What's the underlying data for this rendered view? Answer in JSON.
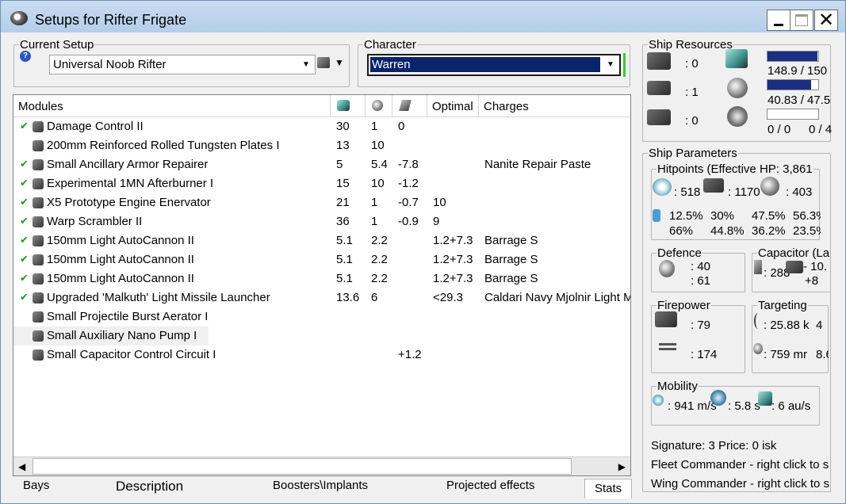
{
  "window": {
    "title": "Setups for Rifter Frigate",
    "minimize_label": "_",
    "close_label": "✕"
  },
  "current_setup": {
    "legend": "Current Setup",
    "help_label": "?",
    "value": "Universal Noob Rifter"
  },
  "character": {
    "legend": "Character",
    "value": "Warren"
  },
  "modules": {
    "headers": {
      "name": "Modules",
      "optimal": "Optimal",
      "charges": "Charges"
    },
    "rows": [
      {
        "checked": true,
        "name": "Damage Control II",
        "c1": "30",
        "c2": "1",
        "c3": "0",
        "optimal": "",
        "charges": ""
      },
      {
        "checked": false,
        "name": "200mm Reinforced Rolled Tungsten Plates I",
        "c1": "13",
        "c2": "10",
        "c3": "",
        "optimal": "",
        "charges": ""
      },
      {
        "checked": true,
        "name": "Small Ancillary Armor Repairer",
        "c1": "5",
        "c2": "5.4",
        "c3": "-7.8",
        "optimal": "",
        "charges": "Nanite Repair Paste"
      },
      {
        "checked": true,
        "name": "Experimental 1MN Afterburner I",
        "c1": "15",
        "c2": "10",
        "c3": "-1.2",
        "optimal": "",
        "charges": ""
      },
      {
        "checked": true,
        "name": "X5 Prototype Engine Enervator",
        "c1": "21",
        "c2": "1",
        "c3": "-0.7",
        "optimal": "10",
        "charges": ""
      },
      {
        "checked": true,
        "name": "Warp Scrambler II",
        "c1": "36",
        "c2": "1",
        "c3": "-0.9",
        "optimal": "9",
        "charges": ""
      },
      {
        "checked": true,
        "name": "150mm Light AutoCannon II",
        "c1": "5.1",
        "c2": "2.2",
        "c3": "",
        "optimal": "1.2+7.3",
        "charges": "Barrage S"
      },
      {
        "checked": true,
        "name": "150mm Light AutoCannon II",
        "c1": "5.1",
        "c2": "2.2",
        "c3": "",
        "optimal": "1.2+7.3",
        "charges": "Barrage S"
      },
      {
        "checked": true,
        "name": "150mm Light AutoCannon II",
        "c1": "5.1",
        "c2": "2.2",
        "c3": "",
        "optimal": "1.2+7.3",
        "charges": "Barrage S"
      },
      {
        "checked": true,
        "name": "Upgraded 'Malkuth' Light Missile Launcher",
        "c1": "13.6",
        "c2": "6",
        "c3": "",
        "optimal": "<29.3",
        "charges": "Caldari Navy Mjolnir Light M"
      },
      {
        "checked": false,
        "name": "Small Projectile Burst Aerator I",
        "c1": "",
        "c2": "",
        "c3": "",
        "optimal": "",
        "charges": ""
      },
      {
        "checked": false,
        "name": "Small Auxiliary Nano Pump I",
        "c1": "",
        "c2": "",
        "c3": "",
        "optimal": "",
        "charges": ""
      },
      {
        "checked": false,
        "name": "Small Capacitor Control Circuit I",
        "c1": "",
        "c2": "",
        "c3": "+1.2",
        "optimal": "",
        "charges": ""
      }
    ]
  },
  "tabs": {
    "bays": "Bays",
    "description": "Description",
    "boosters": "Boosters\\Implants",
    "projected": "Projected effects",
    "stats": "Stats"
  },
  "ship_resources": {
    "legend": "Ship Resources",
    "slots": [
      ": 0",
      ": 1",
      ": 0"
    ],
    "cpu": "148.9 / 150",
    "cpu_fraction": 0.99,
    "power": "40.83 / 47.5",
    "power_fraction": 0.86,
    "drones": "0 / 0",
    "drone_bay": "0 / 4"
  },
  "ship_parameters": {
    "legend": "Ship Parameters",
    "hitpoints": {
      "legend": "Hitpoints (Effective HP: 3,861",
      "shield": ": 518",
      "armor": ": 1170",
      "structure": ": 403",
      "res_row1": [
        "12.5%",
        "30%",
        "47.5%",
        "56.3%"
      ],
      "res_row2": [
        "66%",
        "44.8%",
        "36.2%",
        "23.5%"
      ]
    },
    "defence": {
      "legend": "Defence",
      "v1": ": 40",
      "v2": ": 61"
    },
    "capacitor": {
      "legend": "Capacitor (La",
      "v1": ": 288",
      "v2": "- 10.",
      "v3": "+8"
    },
    "firepower": {
      "legend": "Firepower",
      "v1": ": 79",
      "v2": ": 174"
    },
    "targeting": {
      "legend": "Targeting",
      "v1": ": 25.88 k",
      "v1b": "4",
      "v2": ": 759 mr",
      "v2b": "8.6"
    },
    "mobility": {
      "legend": "Mobility",
      "v1": ": 941 m/s",
      "v2": ": 5.8 s",
      "v3": ": 6 au/s"
    }
  },
  "status": {
    "signature_price": "Signature: 3 Price: 0 isk",
    "fleet": "Fleet Commander - right click to s",
    "wing": "Wing Commander - right click to s"
  },
  "colors": {
    "accent": "#0a246a",
    "check": "#1f9d1f"
  }
}
